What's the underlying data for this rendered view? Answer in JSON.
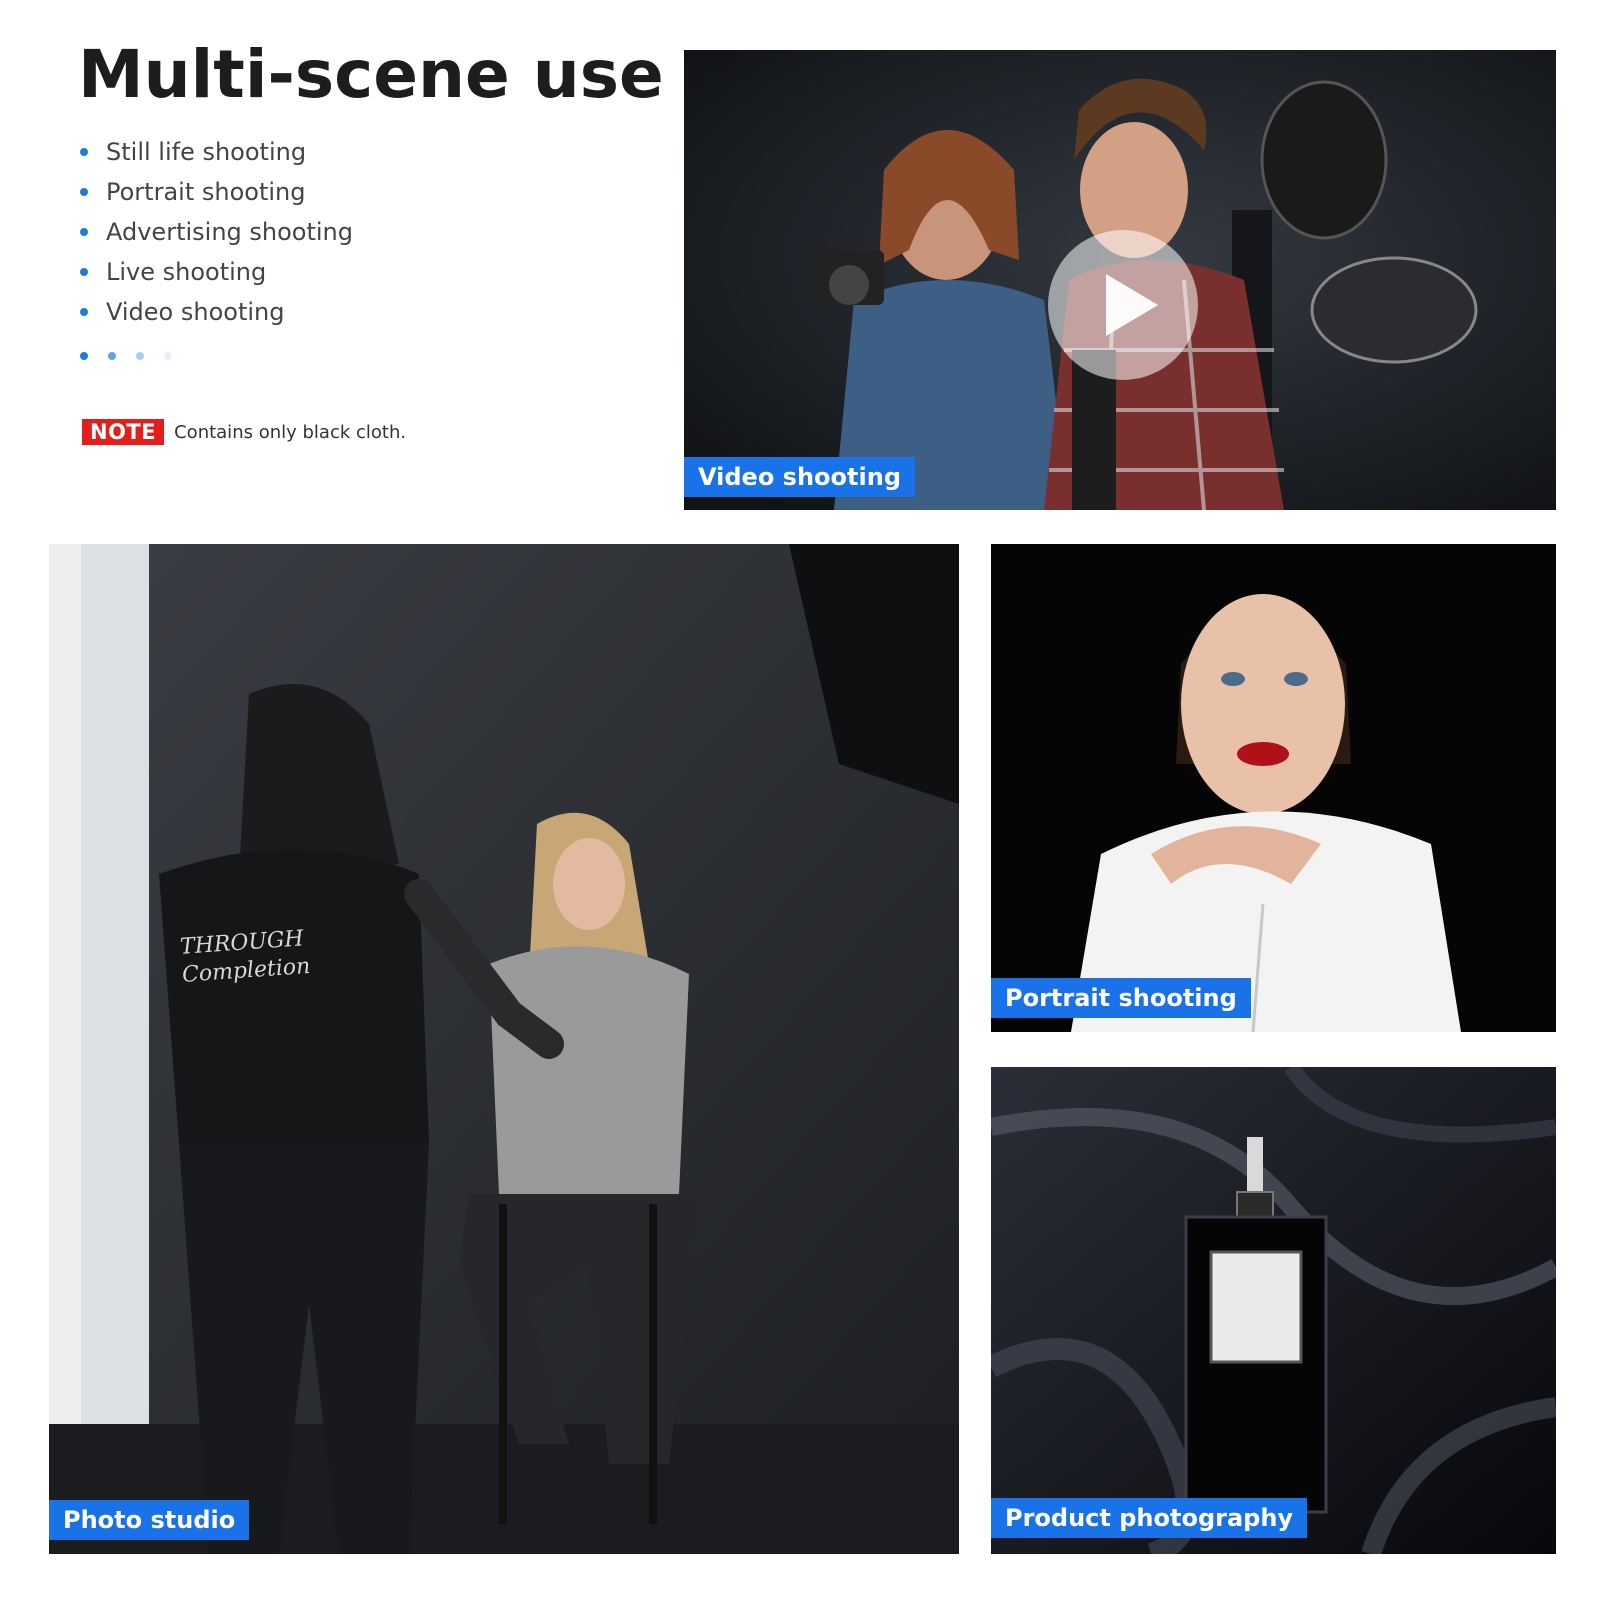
{
  "header": {
    "title": "Multi-scene use",
    "features": [
      "Still life shooting",
      "Portrait shooting",
      "Advertising shooting",
      "Live shooting",
      "Video shooting"
    ],
    "pager_dot_colors": [
      "#1f7ae0",
      "#5fa3f0",
      "#a9cdf7",
      "#e3effc"
    ]
  },
  "note": {
    "tag": "NOTE",
    "text": "Contains only black cloth."
  },
  "scenes": {
    "video": {
      "caption": "Video shooting"
    },
    "studio": {
      "caption": "Photo studio",
      "shirt_text": "THROUGH Completion"
    },
    "portrait": {
      "caption": "Portrait shooting"
    },
    "product": {
      "caption": "Product photography"
    }
  },
  "colors": {
    "accent": "#1a72e8",
    "note_red": "#e41d1d"
  }
}
